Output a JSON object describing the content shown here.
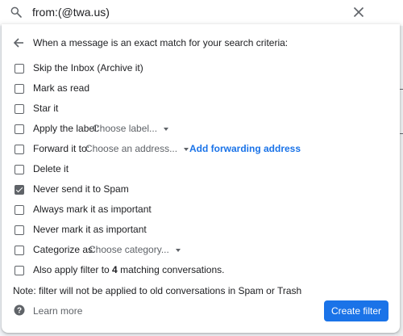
{
  "search": {
    "query": "from:(@twa.us)"
  },
  "colors": {
    "accent": "#1a73e8",
    "text": "#202124",
    "muted": "#5f6368"
  },
  "filter": {
    "header": "When a message is an exact match for your search criteria:",
    "options": [
      {
        "label": "Skip the Inbox (Archive it)",
        "checked": false
      },
      {
        "label": "Mark as read",
        "checked": false
      },
      {
        "label": "Star it",
        "checked": false
      },
      {
        "label": "Apply the label:",
        "checked": false,
        "select": "Choose label..."
      },
      {
        "label": "Forward it to:",
        "checked": false,
        "select": "Choose an address...",
        "link": "Add forwarding address"
      },
      {
        "label": "Delete it",
        "checked": false
      },
      {
        "label": "Never send it to Spam",
        "checked": true
      },
      {
        "label": "Always mark it as important",
        "checked": false
      },
      {
        "label": "Never mark it as important",
        "checked": false
      },
      {
        "label": "Categorize as:",
        "checked": false,
        "select": "Choose category..."
      },
      {
        "label_prefix": "Also apply filter to ",
        "label_count": "4",
        "label_suffix": " matching conversations.",
        "checked": false
      }
    ],
    "note": "Note: filter will not be applied to old conversations in Spam or Trash",
    "learn_more": "Learn more",
    "create_button": "Create filter"
  },
  "icons": {
    "search": "search-icon",
    "close": "close-icon",
    "back": "back-arrow-icon",
    "help": "help-icon"
  }
}
